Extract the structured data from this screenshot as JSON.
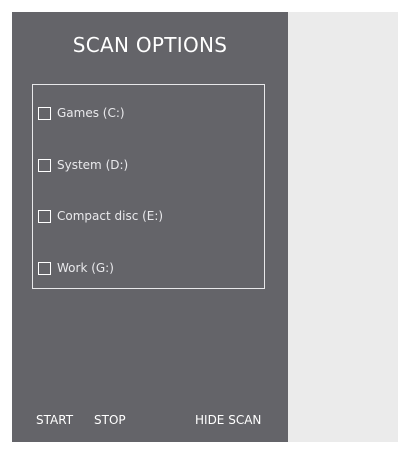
{
  "panel": {
    "title": "SCAN OPTIONS"
  },
  "drives": [
    {
      "label": "Games (C:)",
      "checked": false
    },
    {
      "label": "System (D:)",
      "checked": false
    },
    {
      "label": "Compact disc (E:)",
      "checked": false
    },
    {
      "label": "Work (G:)",
      "checked": false
    }
  ],
  "buttons": {
    "start": "START",
    "stop": "STOP",
    "hide_scan": "HIDE SCAN"
  },
  "colors": {
    "panel_background": "#646469",
    "right_pane_background": "#ebebeb",
    "text": "#ffffff"
  }
}
